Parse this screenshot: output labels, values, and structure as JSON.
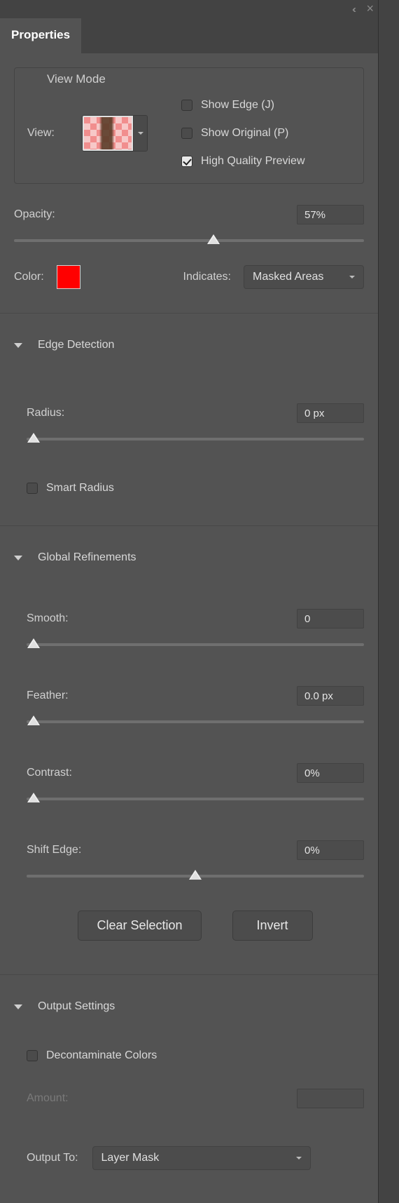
{
  "tab": "Properties",
  "viewMode": {
    "legend": "View Mode",
    "viewLabel": "View:",
    "checks": {
      "showEdge": "Show Edge (J)",
      "showOriginal": "Show Original (P)",
      "highQuality": "High Quality Preview"
    }
  },
  "opacity": {
    "label": "Opacity:",
    "value": "57%",
    "pos": 57
  },
  "colorLabel": "Color:",
  "colorHex": "#ff0000",
  "indicatesLabel": "Indicates:",
  "indicatesValue": "Masked Areas",
  "edgeDetection": {
    "title": "Edge Detection",
    "radiusLabel": "Radius:",
    "radiusValue": "0 px",
    "radiusPos": 0,
    "smartRadius": "Smart Radius"
  },
  "globalRefinements": {
    "title": "Global Refinements",
    "smooth": {
      "label": "Smooth:",
      "value": "0",
      "pos": 0
    },
    "feather": {
      "label": "Feather:",
      "value": "0.0 px",
      "pos": 0
    },
    "contrast": {
      "label": "Contrast:",
      "value": "0%",
      "pos": 0
    },
    "shiftEdge": {
      "label": "Shift Edge:",
      "value": "0%",
      "pos": 50
    },
    "clear": "Clear Selection",
    "invert": "Invert"
  },
  "outputSettings": {
    "title": "Output Settings",
    "decontaminate": "Decontaminate Colors",
    "amountLabel": "Amount:",
    "outputToLabel": "Output To:",
    "outputToValue": "Layer Mask"
  }
}
